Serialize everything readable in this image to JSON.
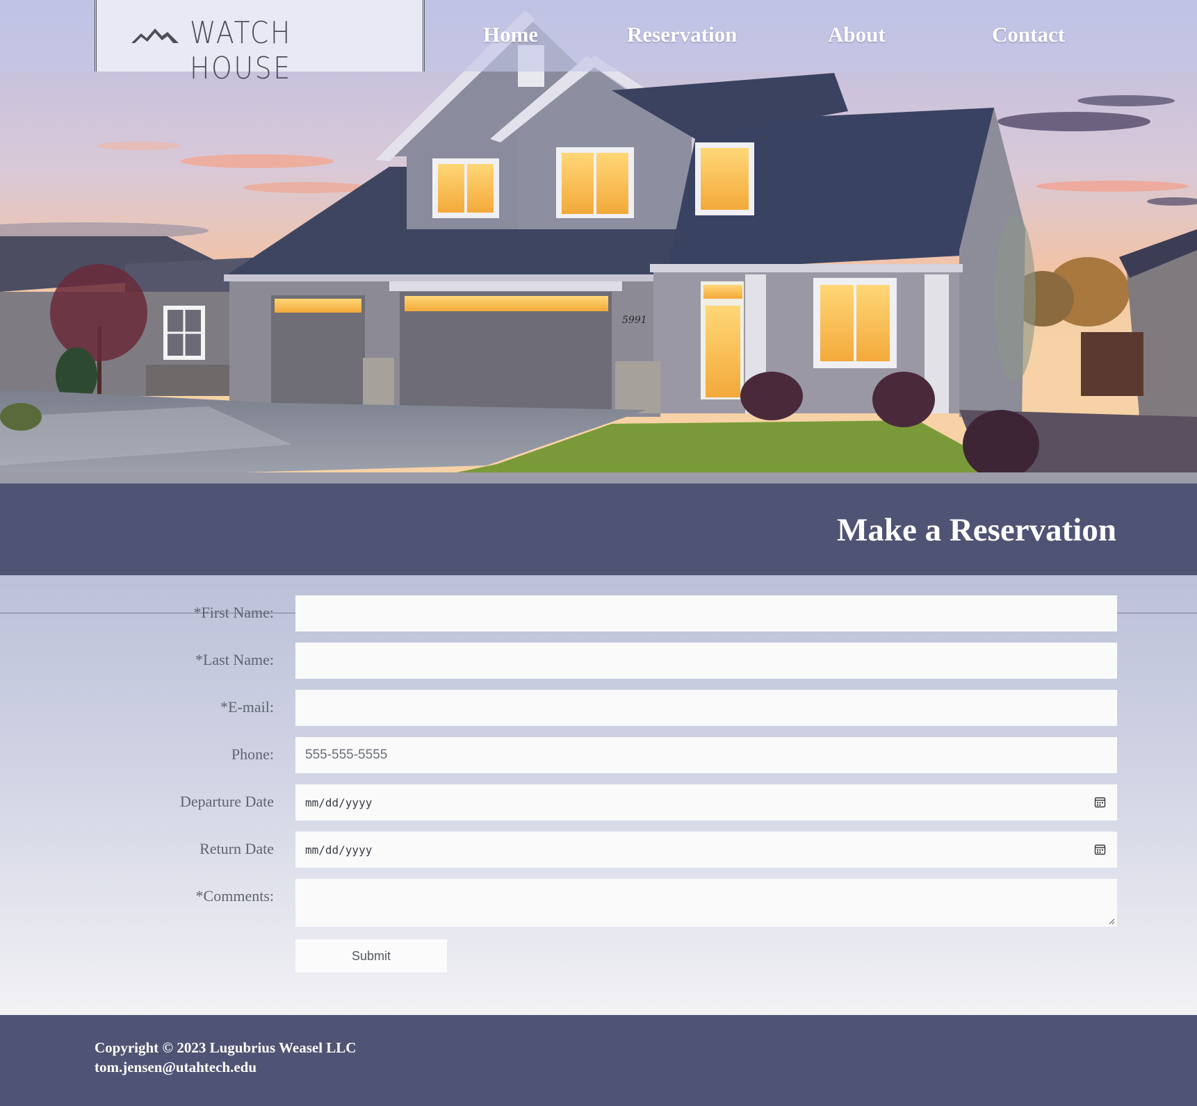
{
  "brand": {
    "logo_text": "WATCH HOUSE",
    "logo_icon": "mountain-icon"
  },
  "nav": {
    "items": [
      {
        "label": "Home"
      },
      {
        "label": "Reservation"
      },
      {
        "label": "About"
      },
      {
        "label": "Contact"
      }
    ]
  },
  "hero": {
    "image": "house-at-dusk-photo",
    "house_number": "5991"
  },
  "page": {
    "title": "Make a Reservation"
  },
  "form": {
    "first_name_label": "*First Name:",
    "last_name_label": "*Last Name:",
    "email_label": "*E-mail:",
    "phone_label": "Phone:",
    "phone_placeholder": "555-555-5555",
    "departure_label": "Departure Date",
    "departure_value": "mm/dd/yyyy",
    "return_label": "Return Date",
    "return_value": "mm/dd/yyyy",
    "comments_label": "*Comments:",
    "submit_label": "Submit"
  },
  "footer": {
    "copyright": "Copyright © 2023 Lugubrius Weasel LLC",
    "email": "tom.jensen@utahtech.edu"
  },
  "colors": {
    "band": "#4f5474",
    "navbar_overlay": "#c4c6e8",
    "text_label": "#5f6470",
    "field_bg": "#fafafa"
  }
}
